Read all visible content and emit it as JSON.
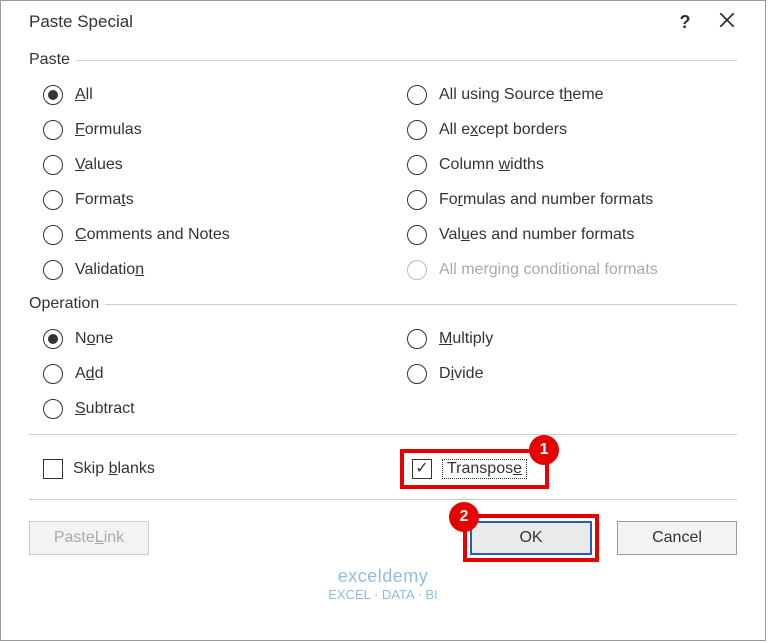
{
  "dialog": {
    "title": "Paste Special",
    "help": "?",
    "close": "×"
  },
  "paste": {
    "legend": "Paste",
    "left": {
      "all": "All",
      "formulas": "Formulas",
      "values": "Values",
      "formats": "Formats",
      "comments": "Comments and Notes",
      "validation": "Validation"
    },
    "right": {
      "sourceTheme": "All using Source theme",
      "exceptBorders": "All except borders",
      "columnWidths": "Column widths",
      "formulasNumFmt": "Formulas and number formats",
      "valuesNumFmt": "Values and number formats",
      "mergingCond": "All merging conditional formats"
    }
  },
  "operation": {
    "legend": "Operation",
    "left": {
      "none": "None",
      "add": "Add",
      "subtract": "Subtract"
    },
    "right": {
      "multiply": "Multiply",
      "divide": "Divide"
    }
  },
  "options": {
    "skipBlanks": "Skip blanks",
    "transpose": "Transpose"
  },
  "buttons": {
    "pasteLink": "Paste Link",
    "ok": "OK",
    "cancel": "Cancel"
  },
  "callouts": {
    "one": "1",
    "two": "2"
  },
  "watermark": {
    "brand": "exceldemy",
    "tagline": "EXCEL · DATA · BI"
  }
}
